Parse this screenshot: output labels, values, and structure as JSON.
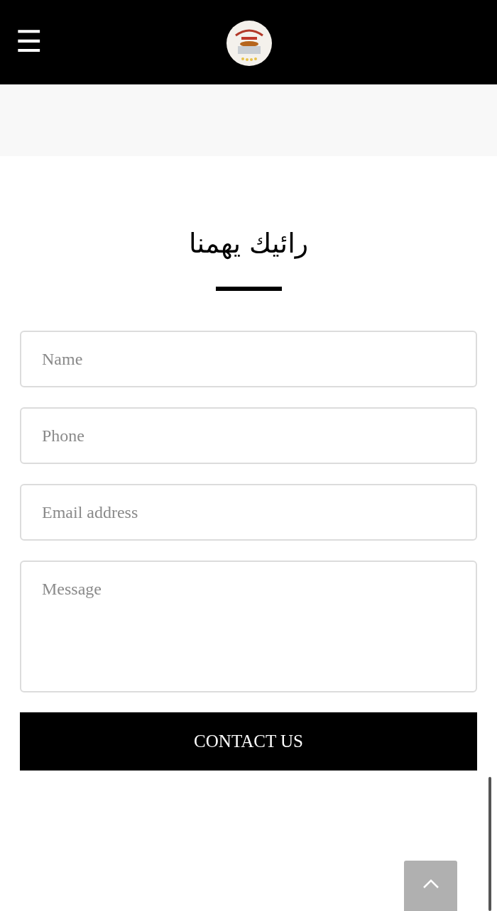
{
  "header": {
    "menu_icon": "☰"
  },
  "section": {
    "title": "رائيك يهمنا"
  },
  "form": {
    "fields": [
      {
        "kind": "input",
        "placeholder": "Name"
      },
      {
        "kind": "input",
        "placeholder": "Phone"
      },
      {
        "kind": "input",
        "placeholder": "Email address"
      },
      {
        "kind": "textarea",
        "placeholder": "Message"
      }
    ],
    "submit": "CONTACT US"
  }
}
